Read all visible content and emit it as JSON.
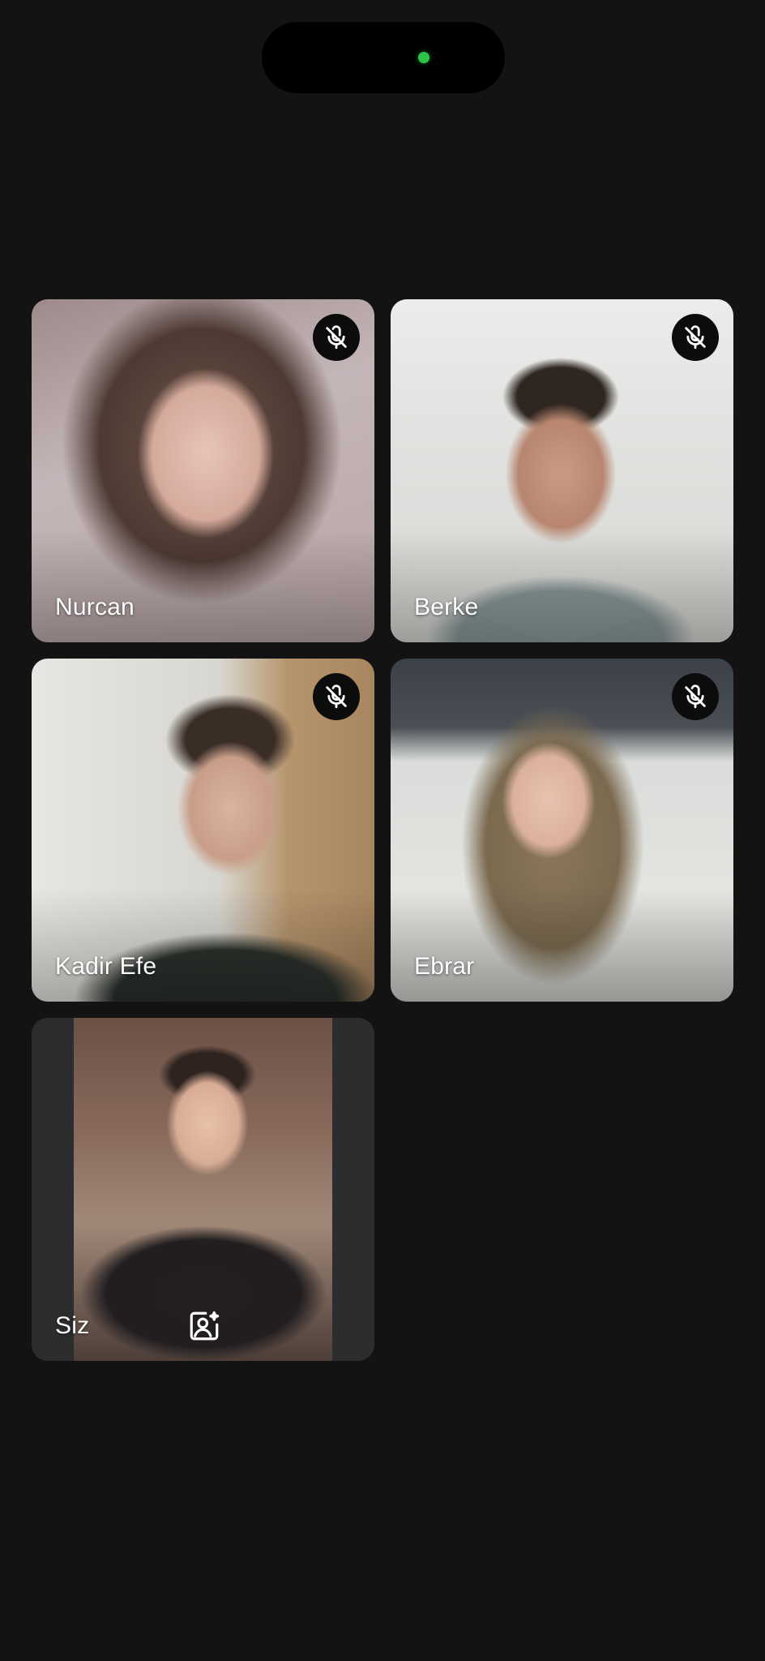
{
  "participants": [
    {
      "name": "Nurcan",
      "muted": true
    },
    {
      "name": "Berke",
      "muted": true
    },
    {
      "name": "Kadir Efe",
      "muted": true
    },
    {
      "name": "Ebrar",
      "muted": true
    }
  ],
  "self": {
    "name": "Siz",
    "effects_icon": "portrait-effects-icon"
  },
  "icons": {
    "mute": "mic-off-icon",
    "camera_indicator": "camera-indicator-dot"
  },
  "colors": {
    "background": "#131313",
    "camera_indicator": "#2ec24a"
  }
}
